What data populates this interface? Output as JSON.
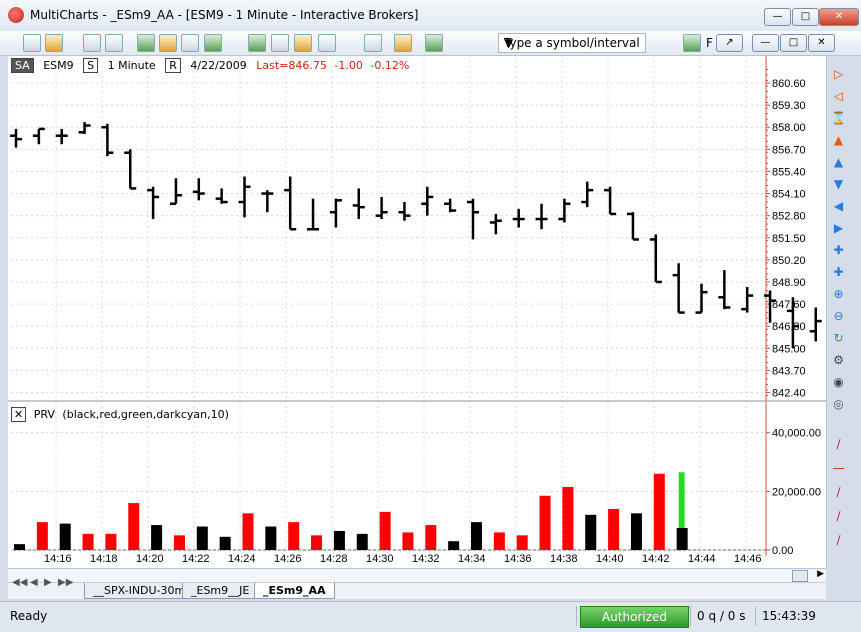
{
  "window": {
    "title": "MultiCharts - _ESm9_AA - [ESM9 - 1 Minute - Interactive Brokers]",
    "buttons": [
      "minimize",
      "restore",
      "close"
    ]
  },
  "toolbar": {
    "symbol_placeholder": "Type a symbol/interval",
    "f_label": "F"
  },
  "chart_header": {
    "mode": "SA",
    "symbol": "ESM9",
    "series_tag": "S",
    "interval": "1 Minute",
    "range_tag": "R",
    "date": "4/22/2009",
    "last": "Last=846.75",
    "change": "-1.00",
    "change_pct": "-0.12%"
  },
  "indicator": {
    "name": "PRV",
    "params": "(black,red,green,darkcyan,10)"
  },
  "chart_data": [
    {
      "type": "ohlc",
      "symbol": "ESM9",
      "y_ticks": [
        "860.60",
        "859.30",
        "858.00",
        "856.70",
        "855.40",
        "854.10",
        "852.80",
        "851.50",
        "850.20",
        "848.90",
        "847.60",
        "846.30",
        "845.00",
        "843.70",
        "842.40"
      ],
      "ylim": [
        841.9,
        861.6
      ],
      "grid": true,
      "bars": [
        {
          "o": 857.5,
          "h": 857.9,
          "l": 856.8,
          "c": 857.3
        },
        {
          "o": 857.5,
          "h": 857.9,
          "l": 857.0,
          "c": 857.9
        },
        {
          "o": 857.5,
          "h": 857.9,
          "l": 857.0,
          "c": 857.5
        },
        {
          "o": 857.7,
          "h": 858.3,
          "l": 857.6,
          "c": 858.1
        },
        {
          "o": 858.0,
          "h": 858.2,
          "l": 856.3,
          "c": 856.5
        },
        {
          "o": 856.5,
          "h": 856.7,
          "l": 854.4,
          "c": 854.4
        },
        {
          "o": 854.3,
          "h": 854.5,
          "l": 852.6,
          "c": 853.9
        },
        {
          "o": 853.5,
          "h": 855.0,
          "l": 853.5,
          "c": 854.0
        },
        {
          "o": 854.2,
          "h": 855.0,
          "l": 853.7,
          "c": 854.1
        },
        {
          "o": 853.8,
          "h": 854.4,
          "l": 853.5,
          "c": 853.6
        },
        {
          "o": 853.6,
          "h": 855.1,
          "l": 852.7,
          "c": 854.5
        },
        {
          "o": 854.1,
          "h": 854.3,
          "l": 853.0,
          "c": 854.1
        },
        {
          "o": 854.3,
          "h": 855.1,
          "l": 852.0,
          "c": 852.0
        },
        {
          "o": 852.0,
          "h": 853.8,
          "l": 852.0,
          "c": 852.0
        },
        {
          "o": 853.0,
          "h": 853.8,
          "l": 852.1,
          "c": 853.7
        },
        {
          "o": 853.4,
          "h": 854.4,
          "l": 852.6,
          "c": 853.3
        },
        {
          "o": 852.8,
          "h": 853.9,
          "l": 852.6,
          "c": 853.0
        },
        {
          "o": 853.0,
          "h": 853.6,
          "l": 852.5,
          "c": 852.8
        },
        {
          "o": 853.5,
          "h": 854.5,
          "l": 852.8,
          "c": 853.9
        },
        {
          "o": 853.5,
          "h": 853.8,
          "l": 853.0,
          "c": 853.1
        },
        {
          "o": 853.6,
          "h": 853.8,
          "l": 851.4,
          "c": 853.0
        },
        {
          "o": 852.4,
          "h": 852.9,
          "l": 851.7,
          "c": 852.5
        },
        {
          "o": 852.6,
          "h": 853.2,
          "l": 852.1,
          "c": 852.6
        },
        {
          "o": 852.6,
          "h": 853.5,
          "l": 852.0,
          "c": 852.6
        },
        {
          "o": 852.6,
          "h": 853.8,
          "l": 852.4,
          "c": 853.5
        },
        {
          "o": 853.6,
          "h": 854.8,
          "l": 853.3,
          "c": 854.3
        },
        {
          "o": 854.3,
          "h": 854.5,
          "l": 852.9,
          "c": 852.9
        },
        {
          "o": 852.9,
          "h": 853.0,
          "l": 851.4,
          "c": 851.4
        },
        {
          "o": 851.4,
          "h": 851.7,
          "l": 848.9,
          "c": 848.9
        },
        {
          "o": 849.3,
          "h": 850.0,
          "l": 847.1,
          "c": 847.1
        },
        {
          "o": 847.1,
          "h": 848.8,
          "l": 847.1,
          "c": 848.3
        },
        {
          "o": 848.0,
          "h": 849.6,
          "l": 847.3,
          "c": 847.4
        },
        {
          "o": 847.3,
          "h": 848.6,
          "l": 847.1,
          "c": 848.1
        },
        {
          "o": 848.1,
          "h": 848.4,
          "l": 846.5,
          "c": 847.8
        },
        {
          "o": 847.2,
          "h": 848.0,
          "l": 845.0,
          "c": 846.3
        },
        {
          "o": 846.0,
          "h": 847.4,
          "l": 845.4,
          "c": 846.6
        }
      ]
    },
    {
      "type": "bar",
      "name": "PRV",
      "y_ticks": [
        "40,000.00",
        "20,000.00",
        "0.00"
      ],
      "ylim": [
        0,
        45000
      ],
      "colors": {
        "down": "#ff0000",
        "up": "#000000",
        "current": "#22dd22"
      },
      "x_ticks": [
        "14:16",
        "14:18",
        "14:20",
        "14:22",
        "14:24",
        "14:26",
        "14:28",
        "14:30",
        "14:32",
        "14:34",
        "14:36",
        "14:38",
        "14:40",
        "14:42",
        "14:44",
        "14:46"
      ],
      "values": [
        2000,
        9500,
        9000,
        5500,
        5500,
        16000,
        8500,
        5000,
        8000,
        4500,
        12500,
        8000,
        9500,
        5000,
        6500,
        5500,
        13000,
        6000,
        8500,
        3000,
        9500,
        6000,
        5000,
        18500,
        21500,
        12000,
        14000,
        12500,
        26000,
        7500
      ],
      "value_colors": [
        "up",
        "down",
        "up",
        "down",
        "down",
        "down",
        "up",
        "down",
        "up",
        "up",
        "down",
        "up",
        "down",
        "down",
        "up",
        "up",
        "down",
        "down",
        "down",
        "up",
        "up",
        "down",
        "down",
        "down",
        "down",
        "up",
        "down",
        "up",
        "down",
        "up"
      ],
      "current_bar": {
        "value": 26500
      }
    }
  ],
  "tabs": [
    "__SPX-INDU-30m",
    "_ESm9__JE",
    "_ESm9_AA"
  ],
  "active_tab": "_ESm9_AA",
  "status": {
    "ready": "Ready",
    "auth": "Authorized",
    "queue": "0 q / 0 s",
    "clock": "15:43:39"
  },
  "icons": {
    "right_toolbar": [
      "zoom-in-icon",
      "zoom-out-icon",
      "pan-icon",
      "scroll-up-icon",
      "scroll-down-icon",
      "move-left-icon",
      "move-right-icon",
      "crosshair-icon",
      "search-plus-icon",
      "search-minus-icon",
      "refresh-icon",
      "settings-icon",
      "eye-icon",
      "trend-line-icon",
      "horizontal-line-icon",
      "parallel-lines-icon"
    ]
  }
}
